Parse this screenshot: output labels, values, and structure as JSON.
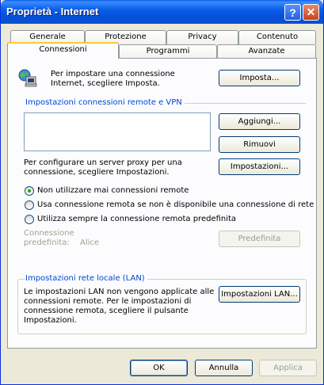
{
  "window": {
    "title": "Proprietà - Internet",
    "help_glyph": "?",
    "close_glyph": "✕"
  },
  "tabs": {
    "row1": [
      "Generale",
      "Protezione",
      "Privacy",
      "Contenuto"
    ],
    "row2": [
      "Connessioni",
      "Programmi",
      "Avanzate"
    ],
    "active": "Connessioni"
  },
  "setup": {
    "text_line1": "Per impostare una connessione",
    "text_line2": "Internet, scegliere Imposta.",
    "button": "Imposta..."
  },
  "dialup": {
    "group_title": "Impostazioni connessioni remote e VPN",
    "add_button": "Aggiungi...",
    "remove_button": "Rimuovi",
    "proxy_line1": "Per configurare un server proxy per una",
    "proxy_line2": "connessione, scegliere Impostazioni.",
    "settings_button": "Impostazioni...",
    "options": [
      {
        "label": "Non utilizzare mai connessioni remote",
        "checked": true
      },
      {
        "label": "Usa connessione remota se non è disponibile una connessione di rete",
        "checked": false
      },
      {
        "label": "Utilizza sempre la connessione remota predefinita",
        "checked": false
      }
    ],
    "default_label_line1": "Connessione",
    "default_label_line2": "predefinita:",
    "default_value": "Alice",
    "default_button": "Predefinita"
  },
  "lan": {
    "group_title": "Impostazioni rete locale (LAN)",
    "text_lines": [
      "Le impostazioni LAN non vengono applicate alle",
      "connessioni remote. Per le impostazioni di",
      "connessione remota, scegliere il pulsante",
      "Impostazioni."
    ],
    "button": "Impostazioni LAN..."
  },
  "footer": {
    "ok": "OK",
    "cancel": "Annulla",
    "apply": "Applica"
  }
}
